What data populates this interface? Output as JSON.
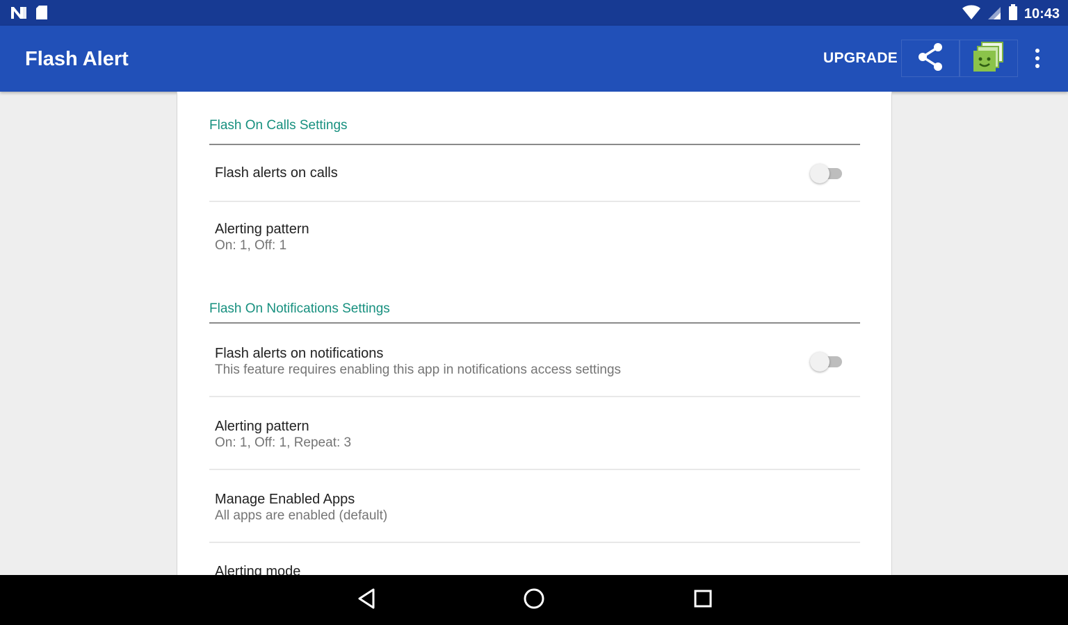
{
  "status_bar": {
    "time": "10:43",
    "left_icons": [
      "n-notification-icon",
      "sd-card-icon"
    ],
    "right_icons": [
      "wifi-icon",
      "cell-signal-icon",
      "battery-icon"
    ]
  },
  "app_bar": {
    "title": "Flash Alert",
    "upgrade_label": "UPGRADE",
    "actions": [
      "share-icon",
      "promo-app-icon",
      "more-vert-icon"
    ]
  },
  "settings": {
    "calls_section": {
      "header": "Flash On Calls Settings",
      "items": [
        {
          "title": "Flash alerts on calls",
          "subtitle": "",
          "has_switch": true,
          "switch_on": false
        },
        {
          "title": "Alerting pattern",
          "subtitle": "On: 1, Off: 1"
        }
      ]
    },
    "notifications_section": {
      "header": "Flash On Notifications Settings",
      "items": [
        {
          "title": "Flash alerts on notifications",
          "subtitle": "This feature requires enabling this app in notifications access settings",
          "has_switch": true,
          "switch_on": false
        },
        {
          "title": "Alerting pattern",
          "subtitle": "On: 1, Off: 1, Repeat: 3"
        },
        {
          "title": "Manage Enabled Apps",
          "subtitle": "All apps are enabled (default)"
        },
        {
          "title": "Alerting mode",
          "subtitle": ""
        }
      ]
    }
  },
  "nav_bar": {
    "buttons": [
      "back-icon",
      "home-icon",
      "recents-icon"
    ]
  },
  "colors": {
    "status_bar": "#173a93",
    "app_bar": "#2150b8",
    "section_header": "#17907f",
    "background": "#eeeeee",
    "card": "#ffffff"
  }
}
